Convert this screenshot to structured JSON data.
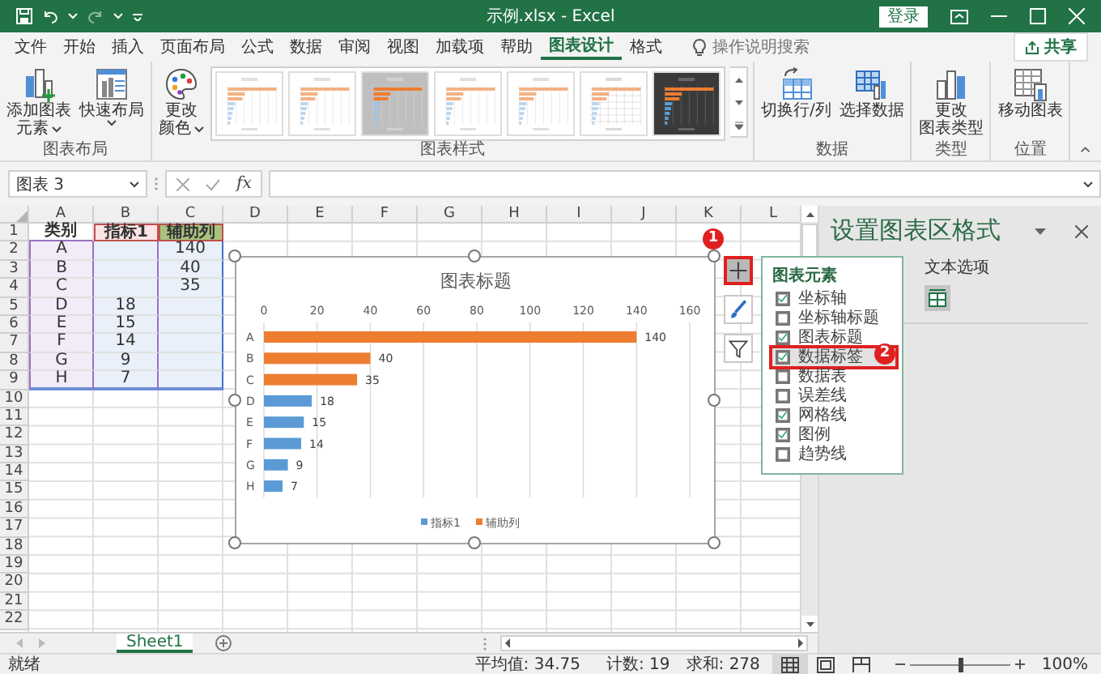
{
  "window": {
    "title": "示例.xlsx  -  Excel",
    "sign_in": "登录"
  },
  "ribbon_tabs": [
    {
      "label": "文件",
      "selected": false
    },
    {
      "label": "开始",
      "selected": false
    },
    {
      "label": "插入",
      "selected": false
    },
    {
      "label": "页面布局",
      "selected": false
    },
    {
      "label": "公式",
      "selected": false
    },
    {
      "label": "数据",
      "selected": false
    },
    {
      "label": "审阅",
      "selected": false
    },
    {
      "label": "视图",
      "selected": false
    },
    {
      "label": "加载项",
      "selected": false
    },
    {
      "label": "帮助",
      "selected": false
    },
    {
      "label": "图表设计",
      "selected": true
    },
    {
      "label": "格式",
      "selected": false
    }
  ],
  "tell_me": {
    "placeholder": "操作说明搜索"
  },
  "share_button": "共享",
  "ribbon_groups": [
    {
      "label": "图表布局",
      "buttons": [
        {
          "lines": [
            "添加图表",
            "元素"
          ],
          "kind": "add-element",
          "dropdown": true
        },
        {
          "lines": [
            "快速布局"
          ],
          "kind": "quick-layout",
          "dropdown": true
        }
      ]
    },
    {
      "label": "图表样式",
      "buttons": [
        {
          "lines": [
            "更改",
            "颜色"
          ],
          "kind": "colors",
          "dropdown": true
        }
      ],
      "gallery": [
        {
          "kind": "light"
        },
        {
          "kind": "light"
        },
        {
          "kind": "gray"
        },
        {
          "kind": "light"
        },
        {
          "kind": "light"
        },
        {
          "kind": "grid"
        },
        {
          "kind": "dark"
        }
      ]
    },
    {
      "label": "数据",
      "buttons": [
        {
          "lines": [
            "切换行/列"
          ],
          "kind": "switch",
          "dropdown": false
        },
        {
          "lines": [
            "选择数据"
          ],
          "kind": "select-data",
          "dropdown": false
        }
      ]
    },
    {
      "label": "类型",
      "buttons": [
        {
          "lines": [
            "更改",
            "图表类型"
          ],
          "kind": "change-type",
          "dropdown": false
        }
      ]
    },
    {
      "label": "位置",
      "buttons": [
        {
          "lines": [
            "移动图表"
          ],
          "kind": "move",
          "dropdown": false
        }
      ]
    }
  ],
  "formula_bar": {
    "name_box": "图表 3",
    "function_label": "fx"
  },
  "sheet": {
    "columns": [
      "A",
      "B",
      "C",
      "D",
      "E",
      "F",
      "G",
      "H",
      "I",
      "J",
      "K",
      "L"
    ],
    "rows": [
      {
        "header": "1",
        "cells": [
          "类别",
          "指标1",
          "辅助列"
        ]
      },
      {
        "header": "2",
        "cells": [
          "A",
          null,
          "140"
        ]
      },
      {
        "header": "3",
        "cells": [
          "B",
          null,
          "40"
        ]
      },
      {
        "header": "4",
        "cells": [
          "C",
          null,
          "35"
        ]
      },
      {
        "header": "5",
        "cells": [
          "D",
          "18",
          null
        ]
      },
      {
        "header": "6",
        "cells": [
          "E",
          "15",
          null
        ]
      },
      {
        "header": "7",
        "cells": [
          "F",
          "14",
          null
        ]
      },
      {
        "header": "8",
        "cells": [
          "G",
          "9",
          null
        ]
      },
      {
        "header": "9",
        "cells": [
          "H",
          "7",
          null
        ]
      },
      {
        "header": "10"
      },
      {
        "header": "11"
      },
      {
        "header": "12"
      },
      {
        "header": "13"
      },
      {
        "header": "14"
      },
      {
        "header": "15"
      },
      {
        "header": "16"
      },
      {
        "header": "17"
      },
      {
        "header": "18"
      },
      {
        "header": "19"
      },
      {
        "header": "20"
      },
      {
        "header": "21"
      },
      {
        "header": "22"
      }
    ]
  },
  "chart": {
    "chart_data": {
      "type": "bar",
      "orientation": "horizontal",
      "title": "图表标题",
      "categories": [
        "A",
        "B",
        "C",
        "D",
        "E",
        "F",
        "G",
        "H"
      ],
      "series": [
        {
          "name": "指标1",
          "color": "#5b9bd5",
          "values": [
            null,
            null,
            null,
            18,
            15,
            14,
            9,
            7
          ]
        },
        {
          "name": "辅助列",
          "color": "#ed7d31",
          "values": [
            140,
            40,
            35,
            null,
            null,
            null,
            null,
            null
          ]
        }
      ],
      "xlim": [
        0,
        160
      ],
      "xticks": [
        0,
        20,
        40,
        60,
        80,
        100,
        120,
        140,
        160
      ],
      "stacked": true,
      "data_labels": true,
      "grid": true,
      "legend": true
    }
  },
  "chart_tools": [
    {
      "kind": "elements",
      "selected": true,
      "highlighted": true
    },
    {
      "kind": "styles",
      "selected": false,
      "highlighted": false
    },
    {
      "kind": "filters",
      "selected": false,
      "highlighted": false
    }
  ],
  "chart_elements": {
    "title": "图表元素",
    "items": [
      {
        "label": "坐标轴",
        "checked": true,
        "highlighted": false
      },
      {
        "label": "坐标轴标题",
        "checked": false,
        "highlighted": false
      },
      {
        "label": "图表标题",
        "checked": true,
        "highlighted": false
      },
      {
        "label": "数据标签",
        "checked": true,
        "highlighted": true
      },
      {
        "label": "数据表",
        "checked": false,
        "highlighted": false
      },
      {
        "label": "误差线",
        "checked": false,
        "highlighted": false
      },
      {
        "label": "网格线",
        "checked": true,
        "highlighted": false
      },
      {
        "label": "图例",
        "checked": true,
        "highlighted": false
      },
      {
        "label": "趋势线",
        "checked": false,
        "highlighted": false
      }
    ]
  },
  "callouts": [
    {
      "label": "1"
    },
    {
      "label": "2"
    }
  ],
  "format_pane": {
    "title": "设置图表区格式",
    "tab": "文本选项"
  },
  "sheet_tabs": [
    {
      "label": "Sheet1",
      "selected": true
    }
  ],
  "status_bar": {
    "mode": "就绪",
    "average": "平均值: 34.75",
    "count": "计数: 19",
    "sum": "求和: 278",
    "views": [
      {
        "kind": "normal",
        "selected": true
      },
      {
        "kind": "page-layout",
        "selected": false
      },
      {
        "kind": "page-break",
        "selected": false
      }
    ],
    "zoom": {
      "level": 0.5,
      "label": "100%"
    }
  }
}
